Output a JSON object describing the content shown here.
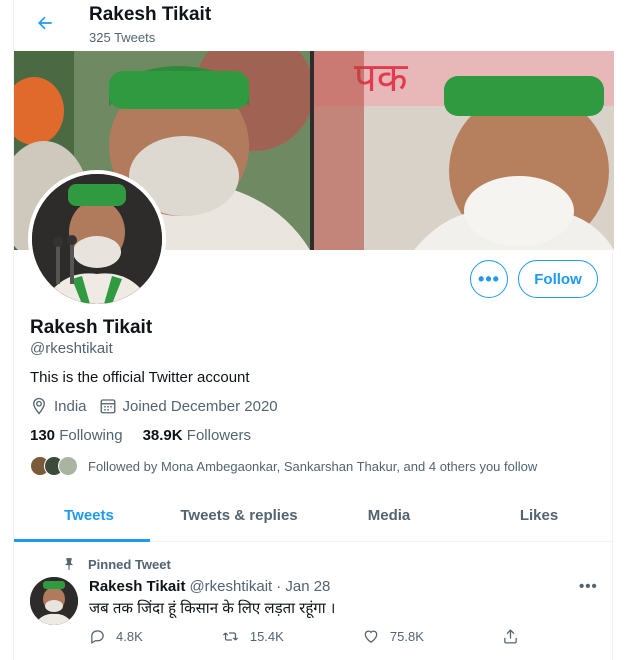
{
  "header": {
    "title": "Rakesh Tikait",
    "subtitle": "325 Tweets"
  },
  "profile": {
    "name": "Rakesh Tikait",
    "handle": "@rkeshtikait",
    "bio": "This is the official Twitter account",
    "location": "India",
    "joined": "Joined December 2020",
    "following_count": "130",
    "following_label": "Following",
    "followers_count": "38.9K",
    "followers_label": "Followers",
    "followed_by": "Followed by Mona Ambegaonkar, Sankarshan Thakur, and 4 others you follow",
    "follow_label": "Follow",
    "more_label": "•••"
  },
  "tabs": [
    {
      "label": "Tweets",
      "active": true
    },
    {
      "label": "Tweets & replies",
      "active": false
    },
    {
      "label": "Media",
      "active": false
    },
    {
      "label": "Likes",
      "active": false
    }
  ],
  "tweet": {
    "pinned_label": "Pinned Tweet",
    "author": "Rakesh Tikait",
    "handle": "@rkeshtikait",
    "date": "· Jan 28",
    "text": "जब तक जिंदा हूं किसान के लिए लड़ता रहूंगा ।",
    "replies": "4.8K",
    "retweets": "15.4K",
    "likes": "75.8K",
    "more_label": "•••"
  },
  "colors": {
    "accent": "#1d9bf0",
    "secondary_text": "#536471",
    "primary_text": "#0f1419"
  },
  "icons": [
    "back-arrow-icon",
    "location-icon",
    "calendar-icon",
    "pin-icon",
    "reply-icon",
    "retweet-icon",
    "like-icon",
    "share-icon"
  ]
}
